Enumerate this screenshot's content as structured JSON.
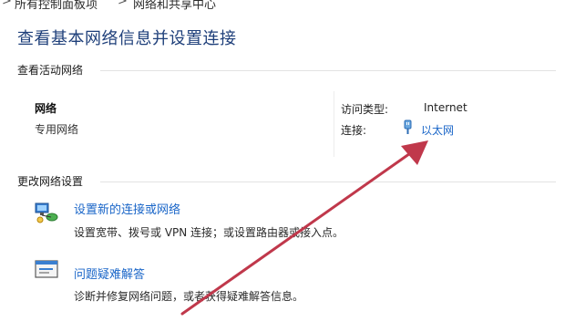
{
  "breadcrumb": {
    "items": [
      "所有控制面板项",
      "网络和共享中心"
    ],
    "separator": ">"
  },
  "page": {
    "title": "查看基本网络信息并设置连接"
  },
  "active_networks": {
    "section_label": "查看活动网络",
    "network_name": "网络",
    "network_type": "专用网络",
    "access_type_label": "访问类型:",
    "access_type_value": "Internet",
    "connection_label": "连接:",
    "connection_value": "以太网"
  },
  "change_settings": {
    "section_label": "更改网络设置",
    "items": [
      {
        "link": "设置新的连接或网络",
        "description": "设置宽带、拨号或 VPN 连接；或设置路由器或接入点。",
        "icon": "network-setup-icon"
      },
      {
        "link": "问题疑难解答",
        "description": "诊断并修复网络问题，或者获得疑难解答信息。",
        "icon": "troubleshoot-icon"
      }
    ]
  },
  "annotation": {
    "arrow_color": "#c0384b"
  },
  "colors": {
    "title": "#1e3f7a",
    "link": "#1a66c8"
  }
}
